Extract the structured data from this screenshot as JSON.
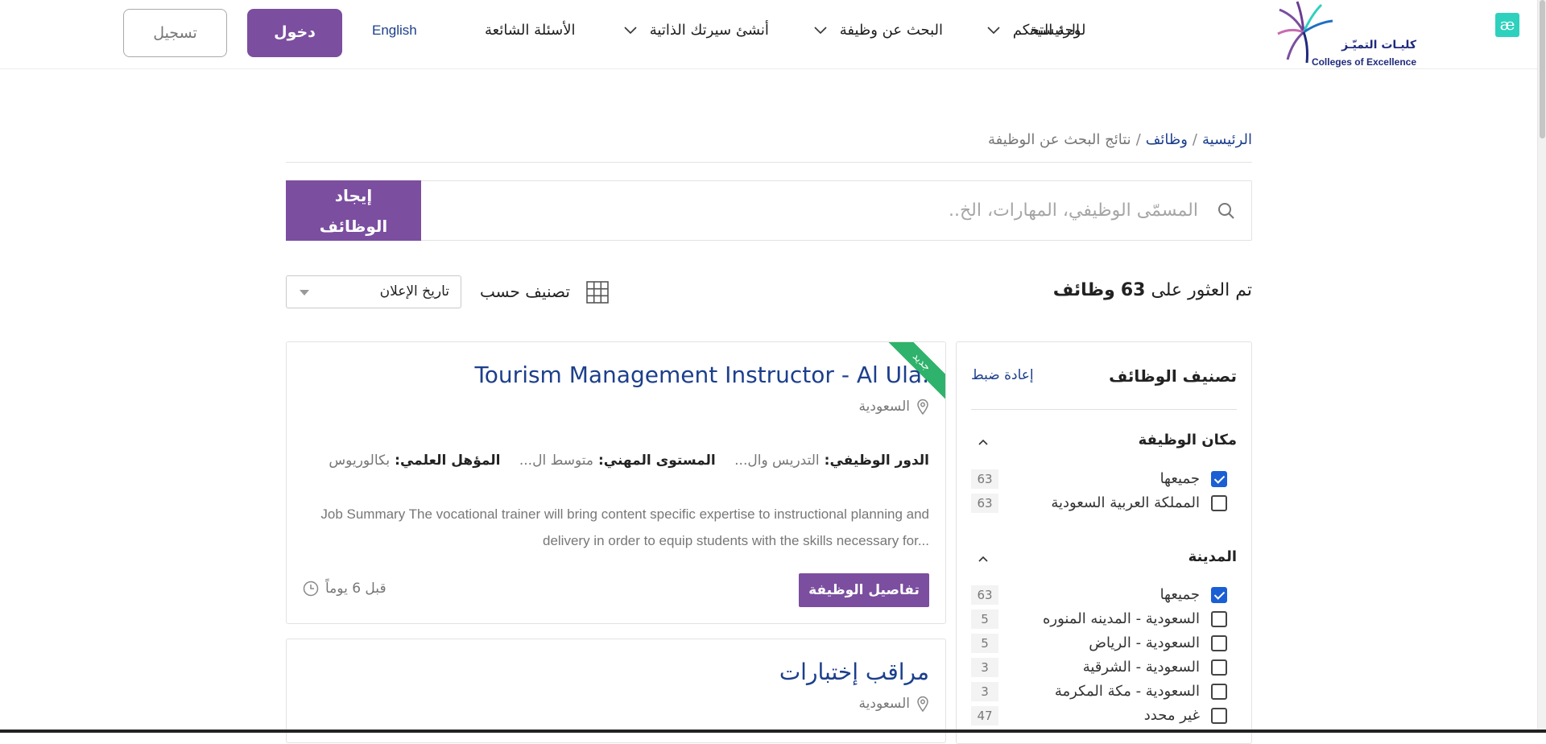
{
  "header": {
    "ae_badge": "æ",
    "logo_ar": "كليـات التميّـز",
    "logo_en": "Colleges of Excellence",
    "nav": {
      "home": "الرئيسية",
      "dashboard": "لوحة التحكم",
      "job_search": "البحث عن وظيفة",
      "create_cv": "أنشئ سيرتك الذاتية",
      "faq": "الأسئلة الشائعة",
      "language": "English",
      "login": "دخول",
      "register": "تسجيل"
    }
  },
  "breadcrumb": {
    "home": "الرئيسية",
    "jobs": "وظائف",
    "current": "نتائج البحث عن الوظيفة",
    "separator": "/"
  },
  "search": {
    "placeholder": "المسمّى الوظيفي، المهارات، الخ..",
    "value": "",
    "button_line1": "إيجاد",
    "button_line2": "الوظائف"
  },
  "results": {
    "prefix": "تم العثور على",
    "count": "63",
    "suffix": "وظائف",
    "sort_label": "تصنيف حسب",
    "sort_value": "تاريخ الإعلان"
  },
  "filters": {
    "title": "تصنيف الوظائف",
    "reset": "إعادة ضبط",
    "groups": [
      {
        "title": "مكان الوظيفة",
        "items": [
          {
            "label": "جميعها",
            "count": "63",
            "checked": true
          },
          {
            "label": "المملكة العربية السعودية",
            "count": "63",
            "checked": false
          }
        ]
      },
      {
        "title": "المدينة",
        "items": [
          {
            "label": "جميعها",
            "count": "63",
            "checked": true
          },
          {
            "label": "السعودية - المدينه المنوره",
            "count": "5",
            "checked": false
          },
          {
            "label": "السعودية - الرياض",
            "count": "5",
            "checked": false
          },
          {
            "label": "السعودية - الشرقية",
            "count": "3",
            "checked": false
          },
          {
            "label": "السعودية - مكة المكرمة",
            "count": "3",
            "checked": false
          },
          {
            "label": "غير محدد",
            "count": "47",
            "checked": false
          }
        ]
      }
    ]
  },
  "jobs": [
    {
      "title": "Tourism Management Instructor - Al Ula.",
      "new_badge": "جديد",
      "location": "السعودية",
      "role_label": "الدور الوظيفي:",
      "role_value": "التدريس وال...",
      "level_label": "المستوى المهني:",
      "level_value": "متوسط ال...",
      "degree_label": "المؤهل العلمي:",
      "degree_value": "بكالوريوس",
      "summary": "Job Summary  The vocational trainer will bring content specific expertise to instructional planning and delivery in order to equip students with the skills necessary for...",
      "details_button": "تفاصيل الوظيفة",
      "posted": "قبل 6 يوماً"
    },
    {
      "title": "مراقب إختبارات",
      "location": "السعودية"
    }
  ],
  "colors": {
    "primary_purple": "#7b4e9f",
    "link_blue": "#1c3f8c",
    "new_green": "#2fb26b",
    "checkbox_blue": "#1a5fd4"
  }
}
